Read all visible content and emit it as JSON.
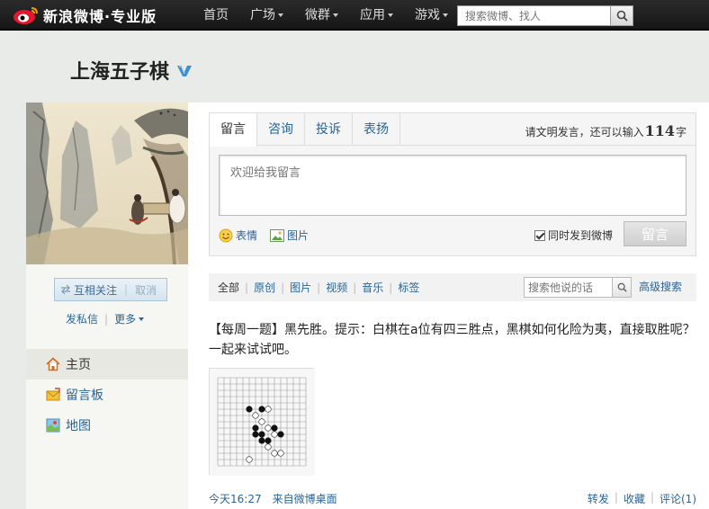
{
  "topbar": {
    "brand": "新浪微博·专业版",
    "nav": [
      {
        "label": "首页",
        "dropdown": false
      },
      {
        "label": "广场",
        "dropdown": true
      },
      {
        "label": "微群",
        "dropdown": true
      },
      {
        "label": "应用",
        "dropdown": true
      },
      {
        "label": "游戏",
        "dropdown": true
      }
    ],
    "search_placeholder": "搜索微博、找人"
  },
  "profile": {
    "name": "上海五子棋",
    "follow_label": "互相关注",
    "cancel_label": "取消",
    "send_message": "发私信",
    "more": "更多"
  },
  "left_nav": [
    {
      "label": "主页",
      "icon": "home-icon",
      "active": true
    },
    {
      "label": "留言板",
      "icon": "message-board-icon",
      "active": false
    },
    {
      "label": "地图",
      "icon": "map-icon",
      "active": false
    }
  ],
  "message_box": {
    "tabs": [
      "留言",
      "咨询",
      "投诉",
      "表扬"
    ],
    "quota_prefix": "请文明发言，还可以输入",
    "quota_count": "114",
    "quota_suffix": "字",
    "placeholder": "欢迎给我留言",
    "emoticon": "表情",
    "image": "图片",
    "sync_label": "同时发到微博",
    "submit": "留言"
  },
  "filter": {
    "links": [
      "全部",
      "原创",
      "图片",
      "视频",
      "音乐",
      "标签"
    ],
    "search_placeholder": "搜索他说的话",
    "advanced": "高级搜索"
  },
  "post": {
    "text": "【每周一题】黑先胜。提示：白棋在a位有四三胜点，黑棋如何化险为夷，直接取胜呢？一起来试试吧。",
    "time": "今天16:27",
    "source": "来自微博桌面",
    "repost": "转发",
    "favorite": "收藏",
    "comment": "评论(1)"
  },
  "colors": {
    "link": "#2a6496",
    "topbar": "#1e1e1e"
  }
}
